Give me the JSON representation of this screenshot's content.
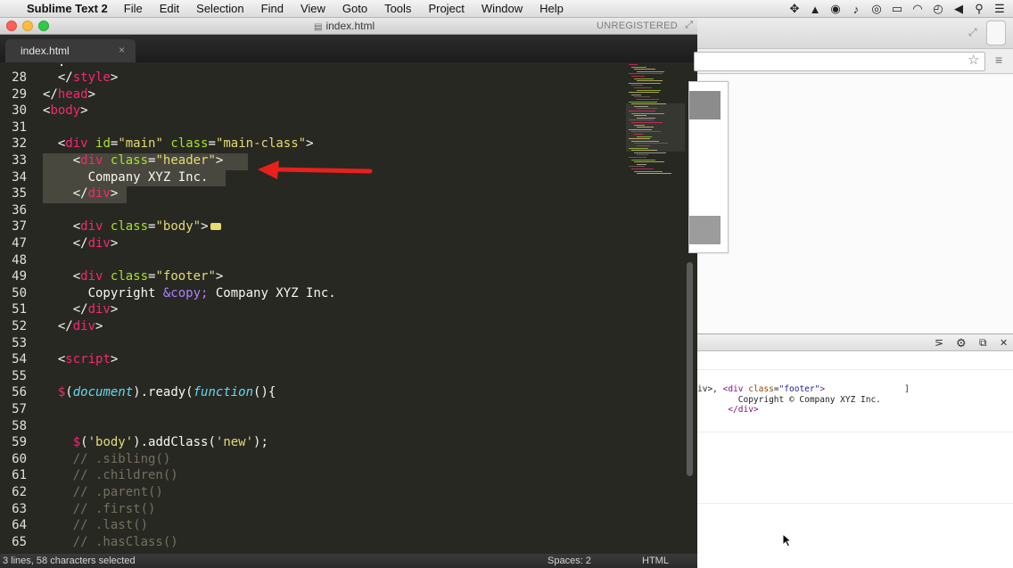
{
  "menubar": {
    "app_name": "Sublime Text 2",
    "menus": [
      "File",
      "Edit",
      "Selection",
      "Find",
      "View",
      "Goto",
      "Tools",
      "Project",
      "Window",
      "Help"
    ]
  },
  "window": {
    "title": "index.html",
    "unregistered": "UNREGISTERED"
  },
  "tab": {
    "label": "index.html",
    "close": "×"
  },
  "editor": {
    "line_numbers": [
      "28",
      "29",
      "30",
      "31",
      "32",
      "33",
      "34",
      "35",
      "36",
      "37",
      "47",
      "48",
      "49",
      "50",
      "51",
      "52",
      "53",
      "54",
      "55",
      "56",
      "57",
      "58",
      "59",
      "60",
      "61",
      "62",
      "63",
      "64",
      "65"
    ]
  },
  "code": {
    "partial_top": "  .",
    "l28": [
      "  </",
      "style",
      ">"
    ],
    "l29": [
      "</",
      "head",
      ">"
    ],
    "l30": [
      "<",
      "body",
      ">"
    ],
    "l32": [
      "  <",
      "div",
      " ",
      "id",
      "=",
      "\"main\"",
      " ",
      "class",
      "=",
      "\"main-class\"",
      ">"
    ],
    "l33": [
      "    <",
      "div",
      " ",
      "class",
      "=",
      "\"header\"",
      ">"
    ],
    "l34": "      Company XYZ Inc.",
    "l35": [
      "    </",
      "div",
      ">"
    ],
    "l37": [
      "    <",
      "div",
      " ",
      "class",
      "=",
      "\"body\"",
      ">"
    ],
    "l47": [
      "    </",
      "div",
      ">"
    ],
    "l49": [
      "    <",
      "div",
      " ",
      "class",
      "=",
      "\"footer\"",
      ">"
    ],
    "l50": [
      "      Copyright ",
      "&copy;",
      " Company XYZ Inc."
    ],
    "l51": [
      "    </",
      "div",
      ">"
    ],
    "l52": [
      "  </",
      "div",
      ">"
    ],
    "l54": [
      "  <",
      "script",
      ">"
    ],
    "l56": [
      "  ",
      "$",
      "(",
      "document",
      ").ready(",
      "function",
      "(){"
    ],
    "l59": [
      "    ",
      "$",
      "(",
      "'body'",
      ").addClass(",
      "'new'",
      ");"
    ],
    "l60": "    // .sibling()",
    "l61": "    // .children()",
    "l62": "    // .parent()",
    "l63": "    // .first()",
    "l64": "    // .last()",
    "l65": "    // .hasClass()"
  },
  "statusbar": {
    "selection": "3 lines, 58 characters selected",
    "spaces": "Spaces: 2",
    "syntax": "HTML"
  },
  "devtools": {
    "console_line1_prefix": "iv>, ",
    "console_tag_open": "<div ",
    "console_attr": "class",
    "console_val": "\"footer\"",
    "console_tag_close": ">",
    "console_line2": "        Copyright © Company XYZ Inc.",
    "console_line3_pre": "      ",
    "console_line3_tag": "</div>",
    "console_bracket": "]"
  },
  "colors": {
    "editor_bg": "#272822",
    "tag": "#f92672",
    "attr": "#a6e22e",
    "string": "#e6db74",
    "comment": "#75715e",
    "selection": "#49483e",
    "arrow": "#e8201c"
  }
}
